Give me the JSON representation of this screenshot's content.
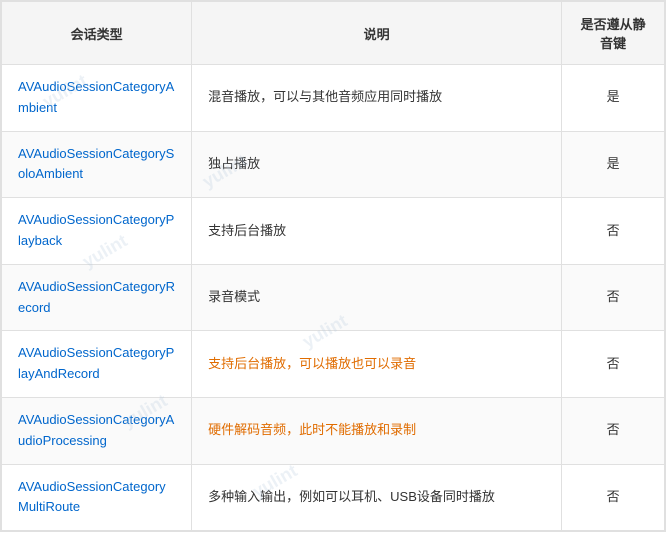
{
  "table": {
    "headers": {
      "type": "会话类型",
      "description": "说明",
      "mute": "是否遵从静音键"
    },
    "rows": [
      {
        "type": "AVAudioSessionCategoryAmbient",
        "description": "混音播放，可以与其他音频应用同时播放",
        "mute": "是",
        "desc_highlight": false
      },
      {
        "type": "AVAudioSessionCategorySoloAmbient",
        "description": "独占播放",
        "mute": "是",
        "desc_highlight": false
      },
      {
        "type": "AVAudioSessionCategoryPlayback",
        "description": "支持后台播放",
        "mute": "否",
        "desc_highlight": false
      },
      {
        "type": "AVAudioSessionCategoryRecord",
        "description": "录音模式",
        "mute": "否",
        "desc_highlight": false
      },
      {
        "type": "AVAudioSessionCategoryPlayAndRecord",
        "description": "支持后台播放，可以播放也可以录音",
        "mute": "否",
        "desc_highlight": true
      },
      {
        "type": "AVAudioSessionCategoryAudioProcessing",
        "description": "硬件解码音频，此时不能播放和录制",
        "mute": "否",
        "desc_highlight": true
      },
      {
        "type": "AVAudioSessionCategoryMultiRoute",
        "description": "多种输入输出，例如可以耳机、USB设备同时播放",
        "mute": "否",
        "desc_highlight": false
      }
    ],
    "watermarks": [
      "yulint",
      "yulint",
      "yulint",
      "yulint",
      "yulint",
      "yulint"
    ]
  }
}
